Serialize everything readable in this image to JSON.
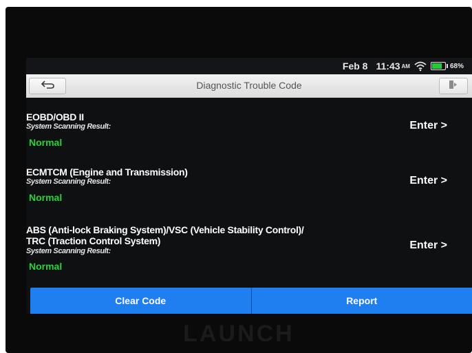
{
  "status": {
    "date": "Feb 8",
    "time": "11:43",
    "ampm": "AM",
    "battery_percent": "68%",
    "battery_level": 0.68
  },
  "header": {
    "title": "Diagnostic Trouble Code"
  },
  "rows": [
    {
      "title_lines": [
        "EOBD/OBD II"
      ],
      "subtitle": "System Scanning Result:",
      "status": "Normal",
      "action": "Enter >"
    },
    {
      "title_lines": [
        "ECMTCM (Engine and Transmission)"
      ],
      "subtitle": "System Scanning Result:",
      "status": "Normal",
      "action": "Enter >"
    },
    {
      "title_lines": [
        "ABS (Anti-lock Braking System)/VSC (Vehicle Stability Control)/",
        "TRC (Traction Control System)"
      ],
      "subtitle": "System Scanning Result:",
      "status": "Normal",
      "action": "Enter >"
    }
  ],
  "footer": {
    "clear_code": "Clear Code",
    "report": "Report"
  },
  "device": {
    "brand": "LAUNCH"
  },
  "colors": {
    "accent": "#1f7ff0",
    "status_ok": "#27d43a"
  }
}
